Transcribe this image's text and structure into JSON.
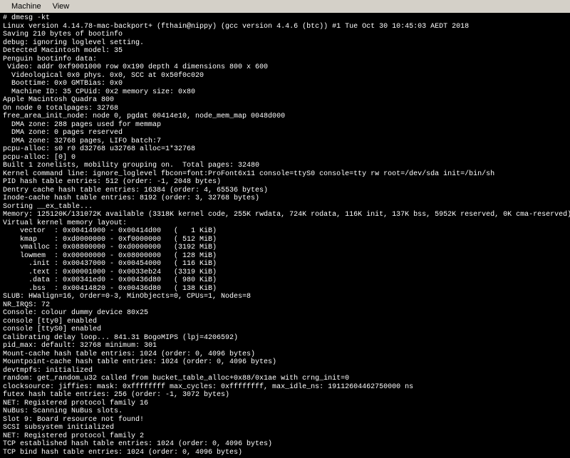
{
  "menubar": {
    "machine": "Machine",
    "view": "View"
  },
  "terminal": {
    "lines": [
      "# dmesg -kt",
      "Linux version 4.14.78-mac-backport+ (fthain@nippy) (gcc version 4.4.6 (btc)) #1 Tue Oct 30 10:45:03 AEDT 2018",
      "Saving 210 bytes of bootinfo",
      "debug: ignoring loglevel setting.",
      "Detected Macintosh model: 35",
      "Penguin bootinfo data:",
      " Video: addr 0xf9001000 row 0x190 depth 4 dimensions 800 x 600",
      "  Videological 0x0 phys. 0x0, SCC at 0x50f0c020",
      "  Boottime: 0x0 GMTBias: 0x0",
      "  Machine ID: 35 CPUid: 0x2 memory size: 0x80",
      "Apple Macintosh Quadra 800",
      "On node 0 totalpages: 32768",
      "free_area_init_node: node 0, pgdat 00414e10, node_mem_map 0048d000",
      "  DMA zone: 288 pages used for memmap",
      "  DMA zone: 0 pages reserved",
      "  DMA zone: 32768 pages, LIFO batch:7",
      "pcpu-alloc: s0 r0 d32768 u32768 alloc=1*32768",
      "pcpu-alloc: [0] 0",
      "Built 1 zonelists, mobility grouping on.  Total pages: 32480",
      "Kernel command line: ignore_loglevel fbcon=font:ProFont6x11 console=ttyS0 console=tty rw root=/dev/sda init=/bin/sh",
      "PID hash table entries: 512 (order: -1, 2048 bytes)",
      "Dentry cache hash table entries: 16384 (order: 4, 65536 bytes)",
      "Inode-cache hash table entries: 8192 (order: 3, 32768 bytes)",
      "Sorting __ex_table...",
      "Memory: 125120K/131072K available (3318K kernel code, 255K rwdata, 724K rodata, 116K init, 137K bss, 5952K reserved, 0K cma-reserved)",
      "Virtual kernel memory layout:",
      "    vector  : 0x00414900 - 0x00414d00   (   1 KiB)",
      "    kmap    : 0xd0000000 - 0xf0000000   ( 512 MiB)",
      "    vmalloc : 0x08800000 - 0xd0000000   (3192 MiB)",
      "    lowmem  : 0x00000000 - 0x08000000   ( 128 MiB)",
      "      .init : 0x00437000 - 0x00454000   ( 116 KiB)",
      "      .text : 0x00001000 - 0x0033eb24   (3319 KiB)",
      "      .data : 0x00341ed0 - 0x00436d80   ( 980 KiB)",
      "      .bss  : 0x00414820 - 0x00436d80   ( 138 KiB)",
      "SLUB: HWalign=16, Order=0-3, MinObjects=0, CPUs=1, Nodes=8",
      "NR_IRQS: 72",
      "Console: colour dummy device 80x25",
      "console [tty0] enabled",
      "console [ttyS0] enabled",
      "Calibrating delay loop... 841.31 BogoMIPS (lpj=4206592)",
      "pid_max: default: 32768 minimum: 301",
      "Mount-cache hash table entries: 1024 (order: 0, 4096 bytes)",
      "Mountpoint-cache hash table entries: 1024 (order: 0, 4096 bytes)",
      "devtmpfs: initialized",
      "random: get_random_u32 called from bucket_table_alloc+0x88/0x1ae with crng_init=0",
      "clocksource: jiffies: mask: 0xffffffff max_cycles: 0xffffffff, max_idle_ns: 19112604462750000 ns",
      "futex hash table entries: 256 (order: -1, 3072 bytes)",
      "NET: Registered protocol family 16",
      "NuBus: Scanning NuBus slots.",
      "Slot 9: Board resource not found!",
      "SCSI subsystem initialized",
      "NET: Registered protocol family 2",
      "TCP established hash table entries: 1024 (order: 0, 4096 bytes)",
      "TCP bind hash table entries: 1024 (order: 0, 4096 bytes)"
    ]
  }
}
